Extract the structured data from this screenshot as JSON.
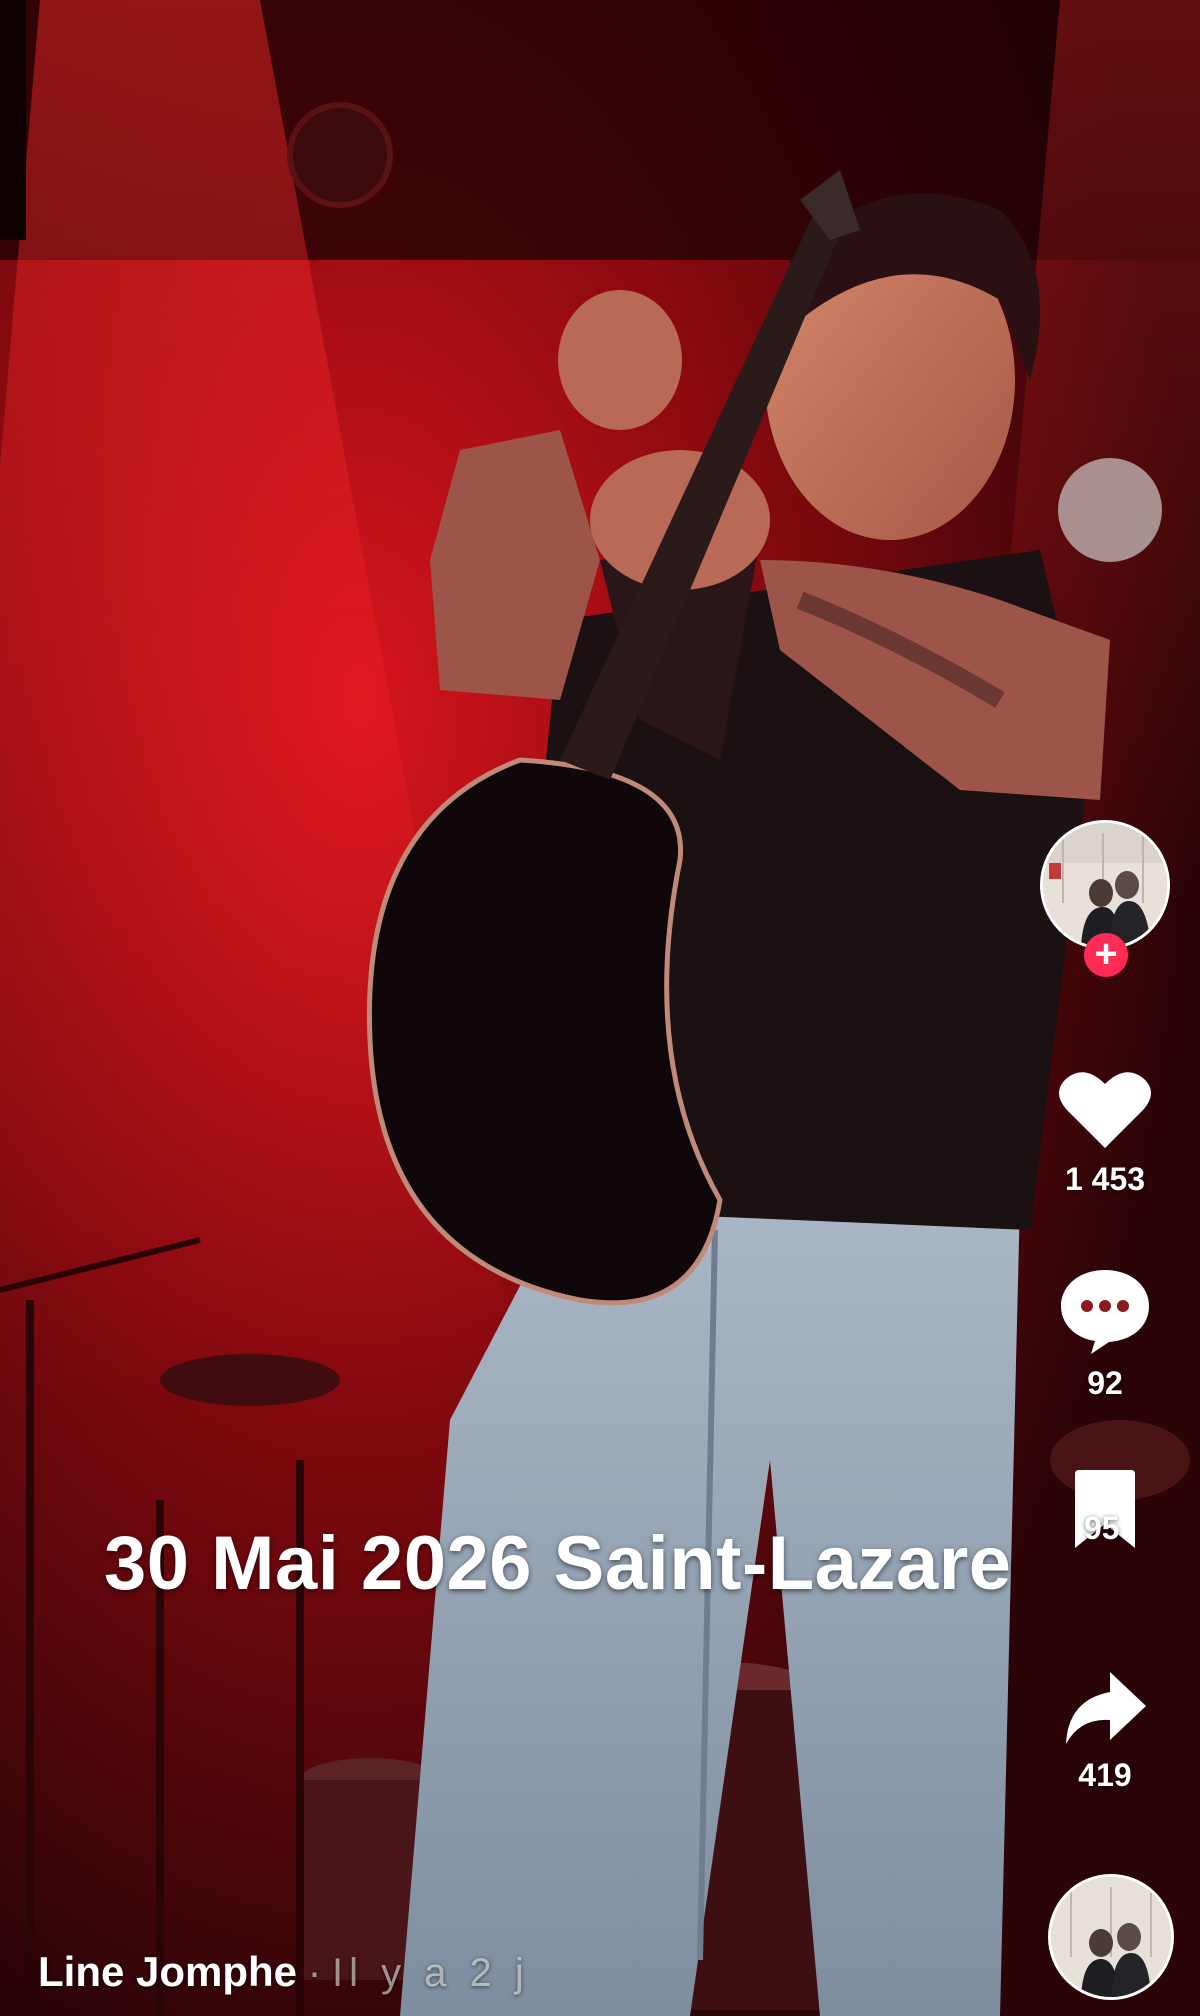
{
  "video": {
    "caption": "30 Mai 2026 Saint-Lazare"
  },
  "creator": {
    "avatar_icon": "profile-photo",
    "follow_symbol": "+"
  },
  "actions": {
    "likes": "1 453",
    "comments": "92",
    "saves": "95",
    "shares": "419"
  },
  "post": {
    "author": "Line Jomphe",
    "separator": "·",
    "time_ago": "Il y a 2 j"
  },
  "colors": {
    "follow_accent": "#fe2c55",
    "stage_light": "#c4121a",
    "background": "#1a0306"
  }
}
